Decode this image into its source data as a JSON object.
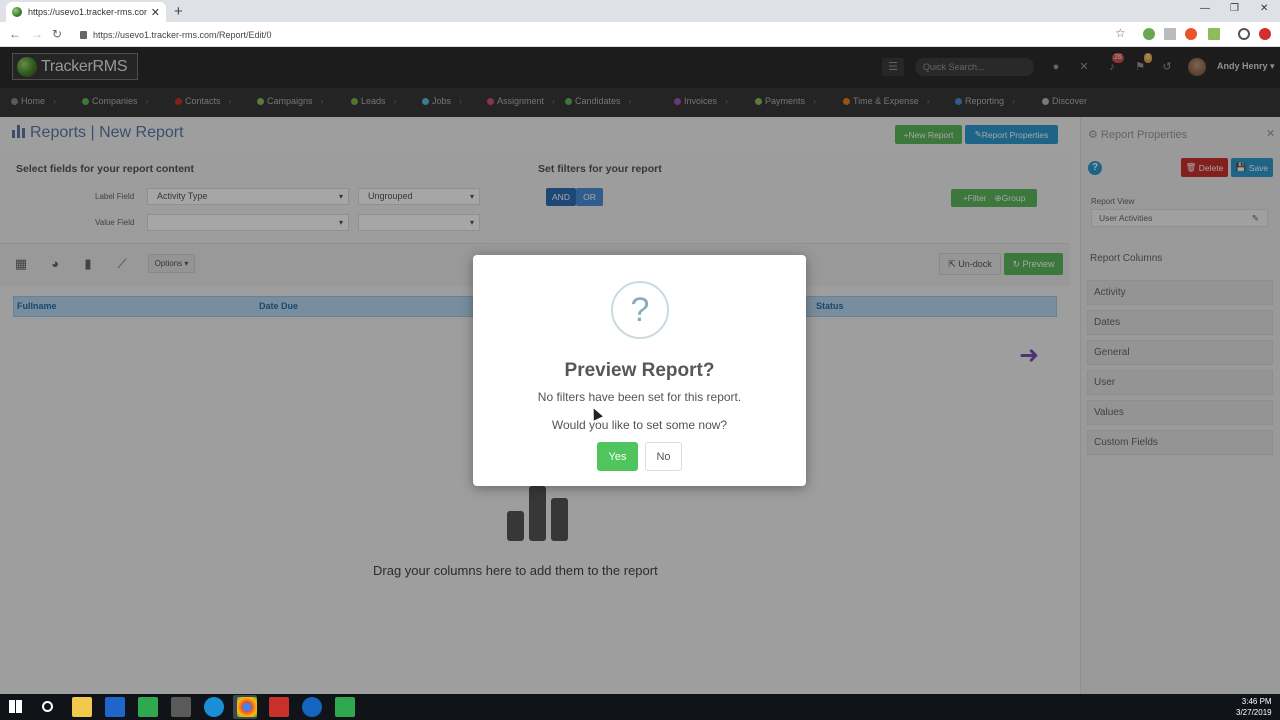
{
  "browser": {
    "tab_title": "https://usevo1.tracker-rms.com/",
    "url": "https://usevo1.tracker-rms.com/Report/Edit/0"
  },
  "app": {
    "logo_text": "TrackerRMS",
    "search_placeholder": "Quick Search...",
    "notifications_count": "26",
    "flag_count": "6",
    "user_name": "Andy Henry"
  },
  "nav": [
    {
      "label": "Home",
      "color": "#8a8a8a"
    },
    {
      "label": "Companies",
      "color": "#5cb85c"
    },
    {
      "label": "Contacts",
      "color": "#c9302c"
    },
    {
      "label": "Campaigns",
      "color": "#8fbc5a"
    },
    {
      "label": "Leads",
      "color": "#7ab648"
    },
    {
      "label": "Jobs",
      "color": "#5bc0de"
    },
    {
      "label": "Assignment",
      "color": "#d84a8a"
    },
    {
      "label": "Candidates",
      "color": "#5cb85c"
    },
    {
      "label": "Invoices",
      "color": "#9b59b6"
    },
    {
      "label": "Payments",
      "color": "#8fbc5a"
    },
    {
      "label": "Time & Expense",
      "color": "#e67e22"
    },
    {
      "label": "Reporting",
      "color": "#4a90d9"
    },
    {
      "label": "Discover",
      "color": "#bbbbbb"
    }
  ],
  "page": {
    "title": "Reports | New Report",
    "new_report": "New Report",
    "report_properties": "Report Properties",
    "select_fields": "Select fields for your report content",
    "label_field": "Label Field",
    "value_field": "Value Field",
    "label_value": "Activity Type",
    "group_value": "Ungrouped",
    "set_filters": "Set filters for your report",
    "and": "AND",
    "or": "OR",
    "filter": "Filter",
    "group": "Group",
    "options": "Options",
    "undock": "Un-dock",
    "preview": "Preview",
    "columns": [
      "Fullname",
      "Date Due",
      "Status"
    ],
    "drop_text": "Drag your columns here to add them to the report"
  },
  "panel": {
    "title": "Report Properties",
    "delete": "Delete",
    "save": "Save",
    "report_view_label": "Report View",
    "report_view_value": "User Activities",
    "report_columns_label": "Report Columns",
    "columns": [
      "Activity",
      "Dates",
      "General",
      "User",
      "Values",
      "Custom Fields"
    ]
  },
  "modal": {
    "icon": "?",
    "title": "Preview Report?",
    "text1": "No filters have been set for this report.",
    "text2": "Would you like to set some now?",
    "yes": "Yes",
    "no": "No"
  },
  "taskbar": {
    "time": "3:46 PM",
    "date": "3/27/2019"
  }
}
